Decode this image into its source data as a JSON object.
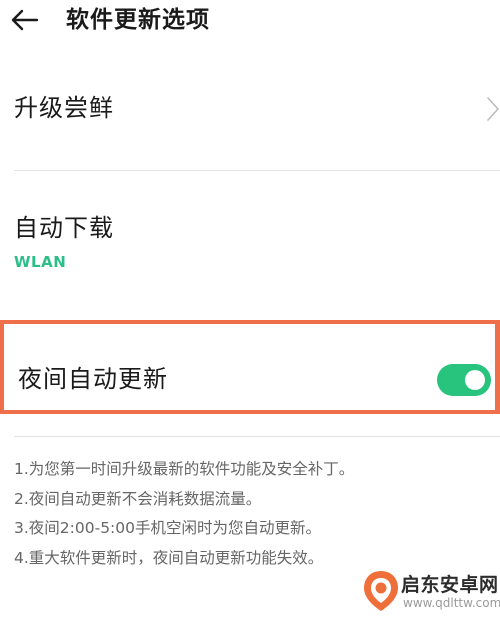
{
  "header": {
    "title": "软件更新选项",
    "back_icon": "arrow-left-icon"
  },
  "settings": {
    "upgrade_early": {
      "label": "升级尝鲜",
      "icon": "chevron-right-icon"
    },
    "auto_download": {
      "label": "自动下载",
      "value": "WLAN"
    },
    "night_auto_update": {
      "label": "夜间自动更新",
      "enabled": true
    }
  },
  "notes": [
    "1.为您第一时间升级最新的软件功能及安全补丁。",
    "2.夜间自动更新不会消耗数据流量。",
    "3.夜间2:00-5:00手机空闲时为您自动更新。",
    "4.重大软件更新时，夜间自动更新功能失效。"
  ],
  "watermark": {
    "title": "启东安卓网",
    "url": "www.qdlttw.com"
  },
  "colors": {
    "accent": "#2bbf87",
    "toggle_on": "#28c37d",
    "highlight_border": "#ef6f4b"
  }
}
